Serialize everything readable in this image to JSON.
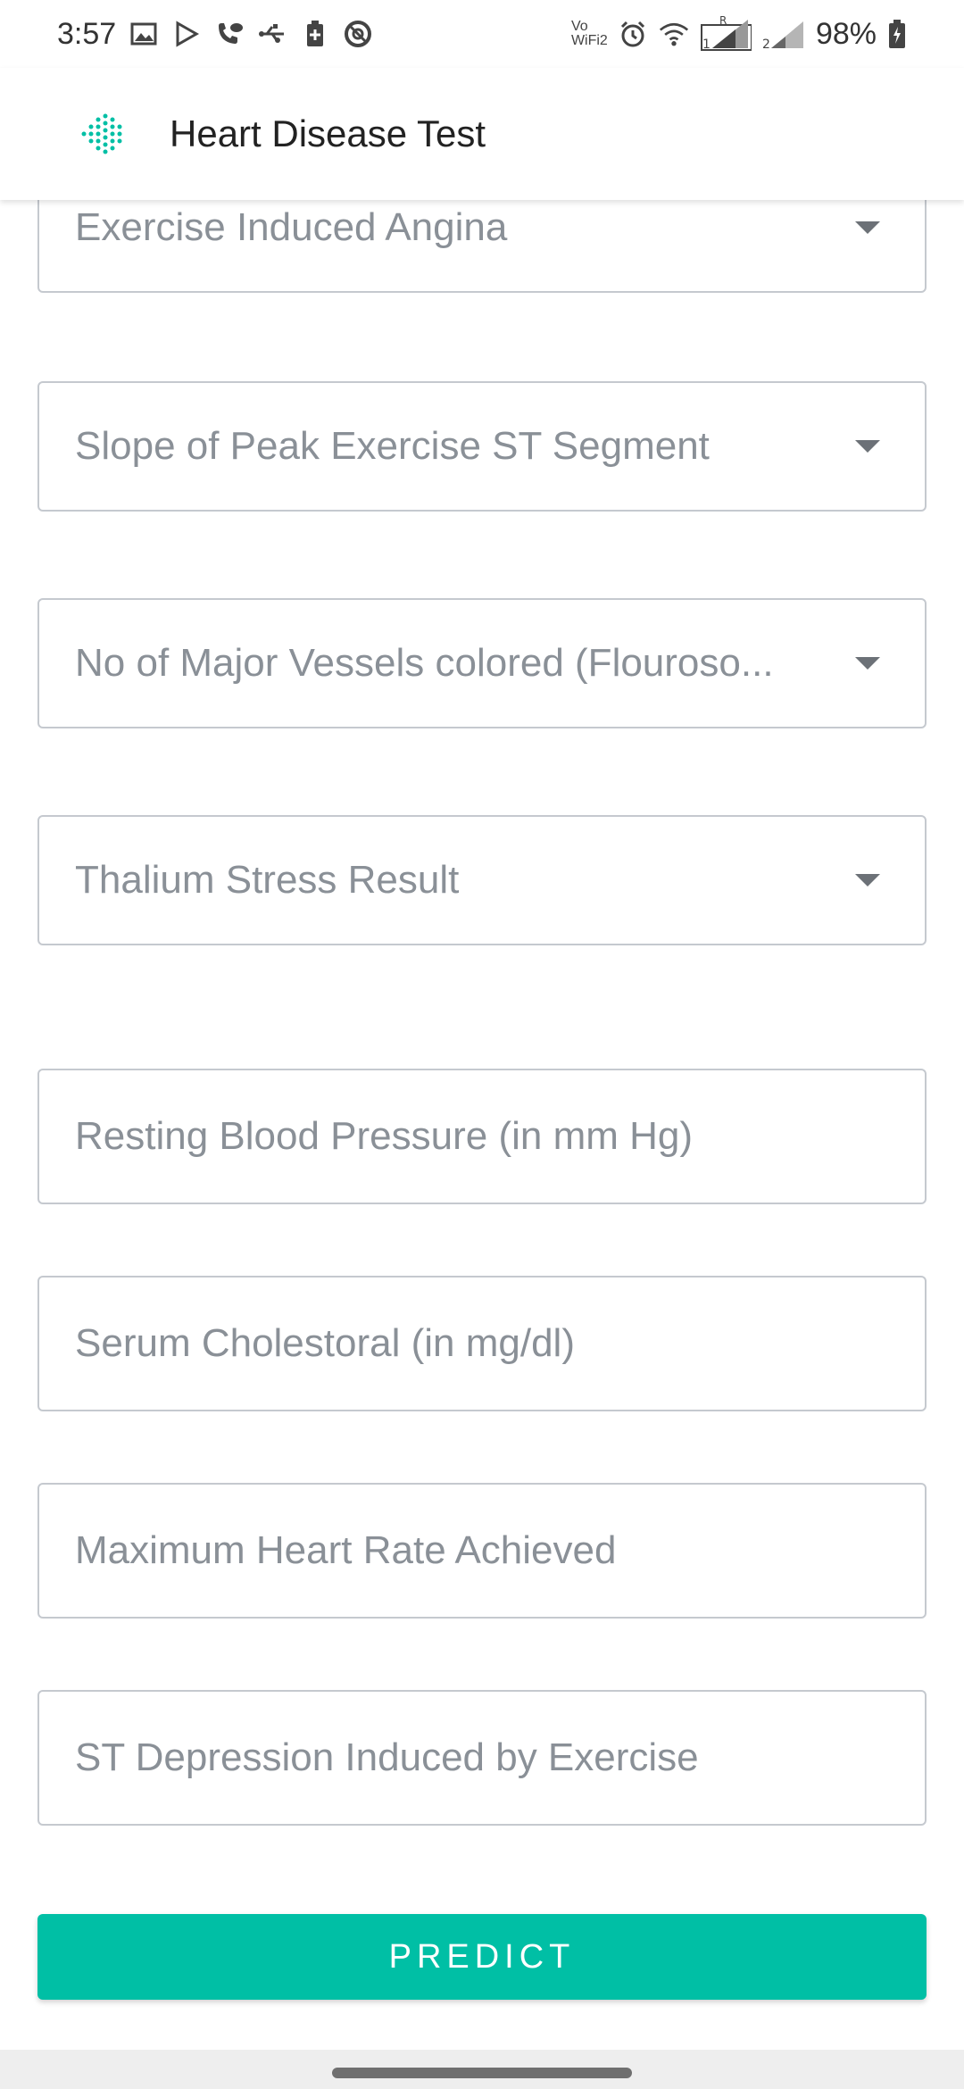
{
  "status_bar": {
    "time": "3:57",
    "vowifi_line1": "Vo",
    "vowifi_line2": "WiFi2",
    "battery": "98%"
  },
  "app_bar": {
    "title": "Heart Disease Test",
    "logo_icon": "heartbeat-dots-icon",
    "accent_color": "#00bfa5"
  },
  "form": {
    "selects": [
      {
        "placeholder": "Exercise Induced Angina"
      },
      {
        "placeholder": "Slope of Peak Exercise ST Segment"
      },
      {
        "placeholder": "No of Major Vessels colored (Flouroso..."
      },
      {
        "placeholder": "Thalium Stress Result"
      }
    ],
    "inputs": [
      {
        "placeholder": "Resting Blood Pressure (in mm Hg)"
      },
      {
        "placeholder": "Serum Cholestoral (in mg/dl)"
      },
      {
        "placeholder": "Maximum Heart Rate Achieved"
      },
      {
        "placeholder": "ST Depression Induced by Exercise"
      }
    ],
    "predict_label": "PREDICT"
  }
}
